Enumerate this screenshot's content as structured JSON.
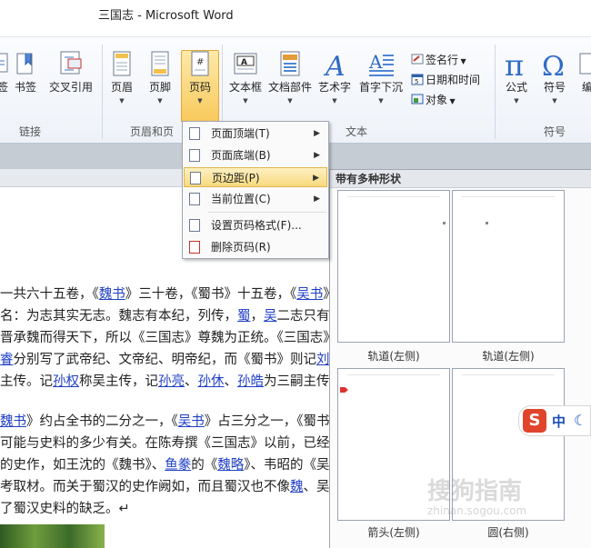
{
  "window": {
    "title": "三国志 - Microsoft Word"
  },
  "ribbon": {
    "links_group": {
      "label": "链接",
      "items": [
        {
          "label": "签"
        },
        {
          "label": "书签"
        },
        {
          "label": "交叉引用"
        }
      ]
    },
    "header_footer_group": {
      "label": "页眉和页",
      "items": [
        {
          "label": "页眉"
        },
        {
          "label": "页脚"
        },
        {
          "label": "页码"
        }
      ]
    },
    "text_group": {
      "label": "文本",
      "items": [
        {
          "label": "文本框"
        },
        {
          "label": "文档部件"
        },
        {
          "label": "艺术字"
        },
        {
          "label": "首字下沉"
        }
      ],
      "small": [
        {
          "label": "签名行",
          "icon": "signature-icon"
        },
        {
          "label": "日期和时间",
          "icon": "calendar-icon"
        },
        {
          "label": "对象",
          "icon": "object-icon"
        }
      ]
    },
    "symbols_group": {
      "label": "符号",
      "items": [
        {
          "label": "公式"
        },
        {
          "label": "符号"
        },
        {
          "label": "编"
        }
      ]
    }
  },
  "page_number_menu": {
    "items": [
      {
        "label": "页面顶端(T)",
        "submenu": true
      },
      {
        "label": "页面底端(B)",
        "submenu": true
      },
      {
        "label": "页边距(P)",
        "submenu": true,
        "active": true
      },
      {
        "label": "当前位置(C)",
        "submenu": true
      },
      {
        "label": "设置页码格式(F)...",
        "submenu": false
      },
      {
        "label": "删除页码(R)",
        "submenu": false
      }
    ]
  },
  "gallery": {
    "heading": "带有多种形状",
    "items": [
      {
        "label": "轨道(左侧)"
      },
      {
        "label": "轨道(左侧)"
      },
      {
        "label": "箭头(左侧)"
      },
      {
        "label": "圆(右侧)"
      }
    ]
  },
  "document": {
    "lines": [
      [
        {
          "t": "一共六十五卷，《"
        },
        {
          "t": "魏书",
          "l": 1
        },
        {
          "t": "》三十卷，《蜀书》十五卷，《"
        },
        {
          "t": "吴书",
          "l": 1
        },
        {
          "t": "》二"
        }
      ],
      [
        {
          "t": " 名：为志其实无志。魏志有本纪，列传，"
        },
        {
          "t": "蜀",
          "l": 1
        },
        {
          "t": "，"
        },
        {
          "t": "吴",
          "l": 1
        },
        {
          "t": "二志只有列传，"
        }
      ],
      [
        {
          "t": "  晋承魏而得天下，所以《三国志》尊魏为正统。《三国志》为"
        }
      ],
      [
        {
          "t": "睿",
          "l": 1
        },
        {
          "t": "分别写了武帝纪、文帝纪、明帝纪，而《蜀书》则记"
        },
        {
          "t": "刘",
          "l": 1
        }
      ],
      [
        {
          "t": "主传。记"
        },
        {
          "t": "孙权",
          "l": 1
        },
        {
          "t": "称吴主传，记"
        },
        {
          "t": "孙亮",
          "l": 1
        },
        {
          "t": "、"
        },
        {
          "t": "孙休",
          "l": 1
        },
        {
          "t": "、"
        },
        {
          "t": "孙皓",
          "l": 1
        },
        {
          "t": "为三嗣主传。均只"
        }
      ],
      [
        {
          "t": "魏书",
          "l": 1
        },
        {
          "t": "》约占全书的二分之一，《"
        },
        {
          "t": "吴书",
          "l": 1
        },
        {
          "t": "》占三分之一，《蜀书》只"
        }
      ],
      [
        {
          "t": "可能与史料的多少有关。在陈寿撰《三国志》以前，已经出现了"
        }
      ],
      [
        {
          "t": "的史作，如王沈的《魏书》、"
        },
        {
          "t": "鱼豢",
          "l": 1
        },
        {
          "t": "的《"
        },
        {
          "t": "魏略",
          "l": 1
        },
        {
          "t": "》、韦昭的《吴书》"
        }
      ],
      [
        {
          "t": "考取材。而关于蜀汉的史作阙如，而且蜀汉也不像"
        },
        {
          "t": "魏",
          "l": 1
        },
        {
          "t": "、吴二国设"
        }
      ],
      [
        {
          "t": "了蜀汉史料的缺乏。↵"
        }
      ]
    ]
  },
  "watermark": {
    "main": "搜狗指南",
    "sub": "zhinan.sogou.com"
  },
  "ime": {
    "logo": "S",
    "mode": "中"
  },
  "colors": {
    "accent_highlight": "#f8c95c",
    "link": "#1f3fc5",
    "ribbon_bg": "#eef2f8"
  }
}
